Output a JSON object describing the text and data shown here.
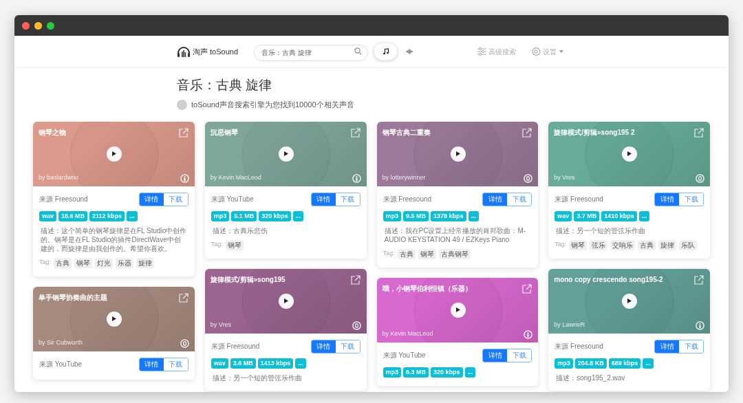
{
  "window": {
    "controls": [
      {
        "color": "#ff5f57"
      },
      {
        "color": "#febc2e"
      },
      {
        "color": "#28c840"
      }
    ]
  },
  "nav": {
    "logo": "淘声 toSound",
    "search": {
      "value": "音乐：古典 旋律"
    },
    "modes": [
      {
        "kind": "music",
        "selected": true
      },
      {
        "kind": "wave",
        "selected": false
      }
    ],
    "advanced": "高级搜索",
    "settings": "设置"
  },
  "heading": {
    "title": "音乐：古典 旋律",
    "subtitle": "toSound声音搜索引擎为您找到10000个相关声音"
  },
  "columns": [
    {
      "cards": [
        {
          "title": "钢琴之物",
          "author": "by baslardwrio",
          "license": {
            "kind": "person"
          },
          "color": "#dc9a8c",
          "source": "来源 Freesound",
          "buttons": [
            {
              "label": "详情",
              "selected": true
            },
            {
              "label": "下载",
              "selected": false
            }
          ],
          "badges": [
            "wav",
            "18.6 MB",
            "2112 kbps",
            "..."
          ],
          "description": "描述：这个简单的钢琴旋律是在FL Studio中创作的。钢琴是在FL Studio的插件DirectWave中创建的，而旋律是由我创作的。希望你喜欢。",
          "tag_label": "Tag:",
          "tags": [
            "古典",
            "钢琴",
            "灯光",
            "乐器",
            "旋律"
          ]
        },
        {
          "title": "单手钢琴协奏曲的主题",
          "author": "by Sir Cubworth",
          "license": {
            "kind": "zero"
          },
          "color": "#a78a7e",
          "source": "来源 YouTube",
          "buttons": [
            {
              "label": "详情",
              "selected": true
            },
            {
              "label": "下载",
              "selected": false
            }
          ]
        }
      ]
    },
    {
      "cards": [
        {
          "title": "沉思钢琴",
          "author": "by Kevin MacLeod",
          "license": {
            "kind": "person"
          },
          "color": "#7fa69b",
          "source": "来源 YouTube",
          "buttons": [
            {
              "label": "详情",
              "selected": true
            },
            {
              "label": "下载",
              "selected": false
            }
          ],
          "badges": [
            "mp3",
            "5.1 MB",
            "320 kbps",
            "..."
          ],
          "description": "描述：古典乐悲伤",
          "tag_label": "Tag:",
          "tags": [
            "钢琴"
          ]
        },
        {
          "title": "旋律模式/剪辑»song195",
          "author": "by Vres",
          "license": {
            "kind": "zero"
          },
          "color": "#9a6590",
          "source": "来源 Freesound",
          "buttons": [
            {
              "label": "详情",
              "selected": true
            },
            {
              "label": "下载",
              "selected": false
            }
          ],
          "badges": [
            "wav",
            "3.6 MB",
            "1413 kbps",
            "..."
          ],
          "description": "描述：另一个短的管弦乐作曲"
        }
      ]
    },
    {
      "cards": [
        {
          "title": "钢琴古典二重奏",
          "author": "by lotterywinner",
          "license": {
            "kind": "zero"
          },
          "color": "#9a7a98",
          "source": "来源 Freesound",
          "buttons": [
            {
              "label": "详情",
              "selected": true
            },
            {
              "label": "下载",
              "selected": false
            }
          ],
          "badges": [
            "mp3",
            "9.5 MB",
            "1378 kbps",
            "..."
          ],
          "description": "描述：我在PC设置上经常播放的肖邦歌曲：M-AUDIO KEYSTATION 49 / EZKeys Piano",
          "tag_label": "Tag:",
          "tags": [
            "古典",
            "钢琴",
            "古典钢琴"
          ]
        },
        {
          "title": "哦，小钢琴伯利恒镇（乐器）",
          "author": "by Kevin MacLeod",
          "license": {
            "kind": "person"
          },
          "color": "#d869cf",
          "source": "来源 YouTube",
          "buttons": [
            {
              "label": "详情",
              "selected": true
            },
            {
              "label": "下载",
              "selected": false
            }
          ],
          "badges": [
            "mp3",
            "6.3 MB",
            "320 kbps",
            "..."
          ]
        }
      ]
    },
    {
      "cards": [
        {
          "title": "旋律模式/剪辑»song195 2",
          "author": "by Vres",
          "license": {
            "kind": "zero"
          },
          "color": "#67ab98",
          "source": "来源 Freesound",
          "buttons": [
            {
              "label": "详情",
              "selected": true
            },
            {
              "label": "下载",
              "selected": false
            }
          ],
          "badges": [
            "wav",
            "3.7 MB",
            "1410 kbps",
            "..."
          ],
          "description": "描述：另一个短的管弦乐作曲",
          "tag_label": "Tag:",
          "tags": [
            "钢琴",
            "弦乐",
            "交响乐",
            "古典",
            "旋律",
            "乐队"
          ]
        },
        {
          "title": "mono copy crescendo song195-2",
          "author": "by LawrieR",
          "license": {
            "kind": "person"
          },
          "color": "#63a099",
          "source": "来源 Freesound",
          "buttons": [
            {
              "label": "详情",
              "selected": true
            },
            {
              "label": "下载",
              "selected": false
            }
          ],
          "badges": [
            "mp3",
            "204.8 KB",
            "689 kbps",
            "..."
          ],
          "description": "描述：song195_2.wav"
        }
      ]
    }
  ]
}
